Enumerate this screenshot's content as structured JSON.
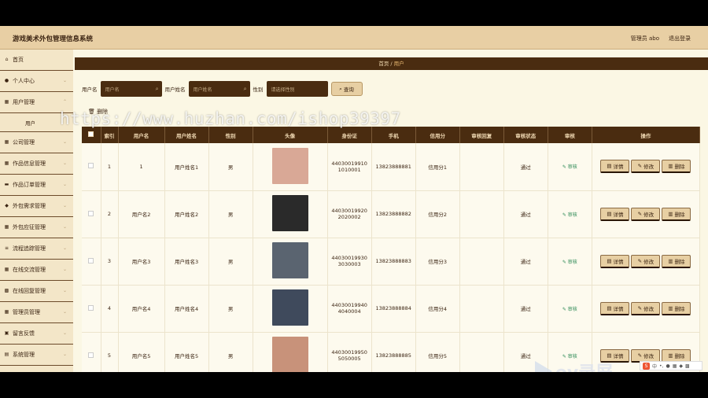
{
  "app": {
    "title": "游戏美术外包管理信息系统",
    "admin_label": "管理员 abo",
    "logout": "退出登录"
  },
  "sidebar": {
    "items": [
      {
        "label": "首页",
        "icon": "home-icon",
        "glyph": "⌂"
      },
      {
        "label": "个人中心",
        "icon": "user-icon",
        "glyph": "●",
        "chevron": "⌄"
      },
      {
        "label": "用户管理",
        "icon": "grid-icon",
        "glyph": "▦",
        "chevron": "⌃"
      },
      {
        "label": "公司管理",
        "icon": "grid-icon",
        "glyph": "▦",
        "chevron": "⌄"
      },
      {
        "label": "作品信息管理",
        "icon": "grid-icon",
        "glyph": "▦",
        "chevron": "⌄"
      },
      {
        "label": "作品订单管理",
        "icon": "cart-icon",
        "glyph": "▬",
        "chevron": "⌄"
      },
      {
        "label": "外包需求管理",
        "icon": "tag-icon",
        "glyph": "◆",
        "chevron": "⌄"
      },
      {
        "label": "外包应征管理",
        "icon": "grid-icon",
        "glyph": "▦",
        "chevron": "⌄"
      },
      {
        "label": "流程追踪管理",
        "icon": "list-icon",
        "glyph": "≡",
        "chevron": "⌄"
      },
      {
        "label": "在线交流管理",
        "icon": "grid-icon",
        "glyph": "▦",
        "chevron": "⌄"
      },
      {
        "label": "在线回复管理",
        "icon": "box-icon",
        "glyph": "▩",
        "chevron": "⌄"
      },
      {
        "label": "管理员管理",
        "icon": "grid-icon",
        "glyph": "▦",
        "chevron": "⌄"
      },
      {
        "label": "留言反馈",
        "icon": "message-icon",
        "glyph": "▣",
        "chevron": "⌄"
      },
      {
        "label": "系统管理",
        "icon": "settings-icon",
        "glyph": "▤",
        "chevron": "⌄"
      }
    ],
    "sub_item": "用户"
  },
  "breadcrumb": {
    "home": "首页",
    "sep": "/",
    "current": "用户"
  },
  "search": {
    "label1": "用户名",
    "placeholder1": "用户名",
    "label2": "用户姓名",
    "placeholder2": "用户姓名",
    "label3": "性别",
    "placeholder3": "请选择性别",
    "search_button": "查询"
  },
  "actions": {
    "delete": "删除"
  },
  "table": {
    "headers": [
      "索引",
      "用户名",
      "用户姓名",
      "性别",
      "头像",
      "身份证",
      "手机",
      "信用分",
      "审核回复",
      "审核状态",
      "审核",
      "操作"
    ],
    "rows": [
      {
        "index": "1",
        "username": "1",
        "name": "用户姓名1",
        "gender": "男",
        "id_line1": "44030019910",
        "id_line2": "1010001",
        "phone": "13823888881",
        "credit": "信用分1",
        "reply": "",
        "status": "通过",
        "audit": "审核",
        "avatar_color": "#d9a896"
      },
      {
        "index": "2",
        "username": "用户名2",
        "name": "用户姓名2",
        "gender": "男",
        "id_line1": "44030019920",
        "id_line2": "2020002",
        "phone": "13823888882",
        "credit": "信用分2",
        "reply": "",
        "status": "通过",
        "audit": "审核",
        "avatar_color": "#2a2a2a"
      },
      {
        "index": "3",
        "username": "用户名3",
        "name": "用户姓名3",
        "gender": "男",
        "id_line1": "44030019930",
        "id_line2": "3030003",
        "phone": "13823888883",
        "credit": "信用分3",
        "reply": "",
        "status": "通过",
        "audit": "审核",
        "avatar_color": "#5a6470"
      },
      {
        "index": "4",
        "username": "用户名4",
        "name": "用户姓名4",
        "gender": "男",
        "id_line1": "44030019940",
        "id_line2": "4040004",
        "phone": "13823888884",
        "credit": "信用分4",
        "reply": "",
        "status": "通过",
        "audit": "审核",
        "avatar_color": "#3f4a5c"
      },
      {
        "index": "5",
        "username": "用户名5",
        "name": "用户姓名5",
        "gender": "男",
        "id_line1": "44030019950",
        "id_line2": "5050005",
        "phone": "13823888885",
        "credit": "信用分5",
        "reply": "",
        "status": "通过",
        "audit": "审核",
        "avatar_color": "#c8927a"
      }
    ],
    "ops": {
      "detail": "详情",
      "edit": "修改",
      "delete": "删除"
    }
  },
  "watermark": "https://www.huzhan.com/ishop39397",
  "overlay": {
    "ev_text": "ev录屏",
    "ime_char": "中",
    "ime_s": "S"
  }
}
